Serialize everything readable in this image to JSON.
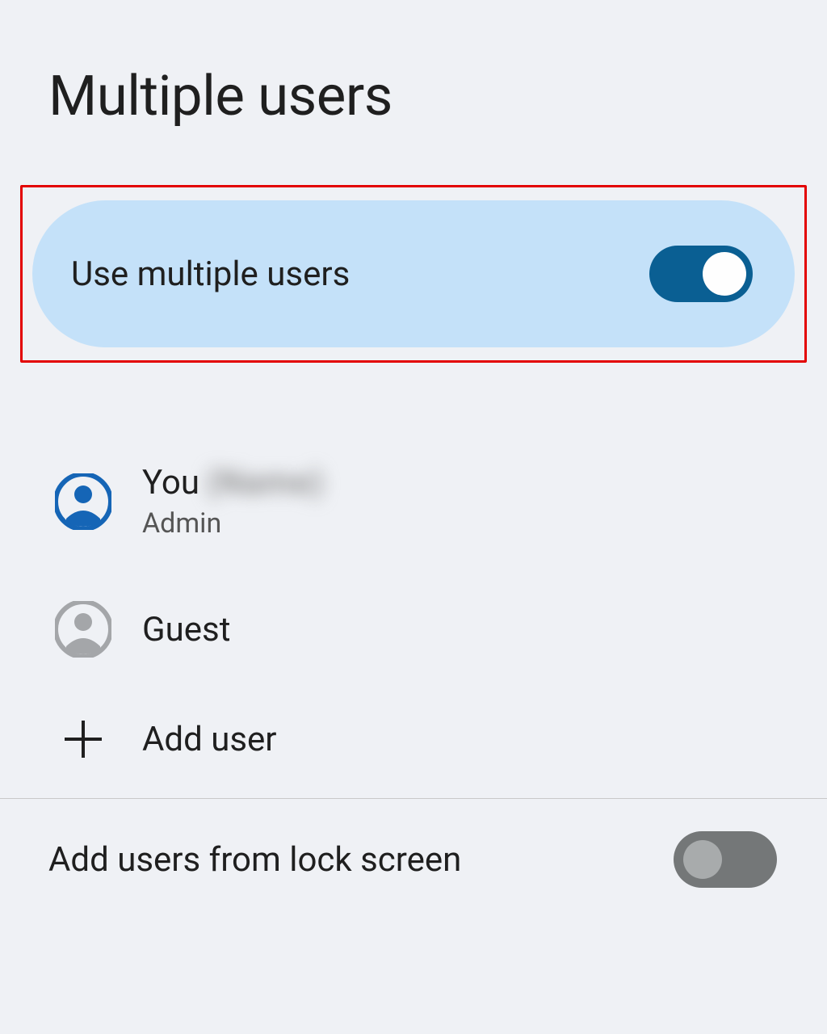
{
  "page_title": "Multiple users",
  "toggle": {
    "label": "Use multiple users",
    "on": true
  },
  "users": [
    {
      "name": "You",
      "redacted": "(Name)",
      "subtitle": "Admin",
      "icon": "user-filled"
    },
    {
      "name": "Guest",
      "icon": "user-outline"
    }
  ],
  "add_user_label": "Add user",
  "lock_screen": {
    "label": "Add users from lock screen",
    "on": false
  }
}
